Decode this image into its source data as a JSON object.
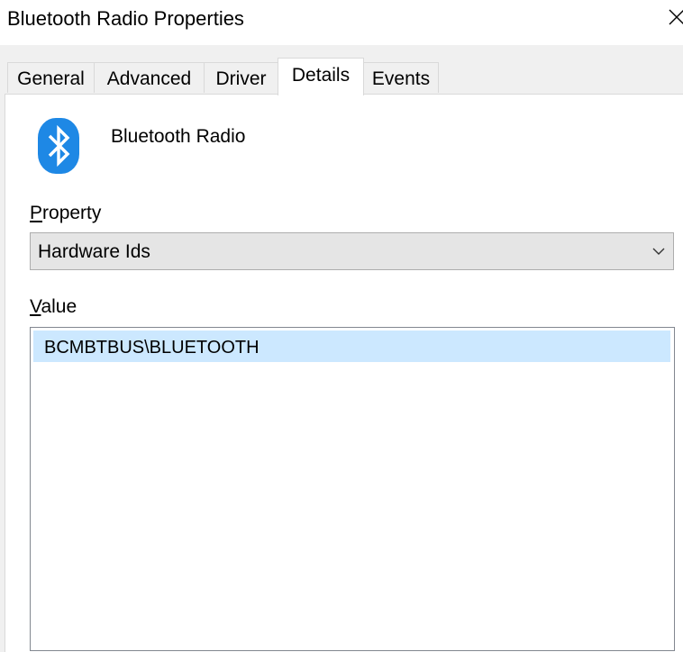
{
  "window": {
    "title": "Bluetooth Radio Properties",
    "close_icon": "close-icon"
  },
  "tabs": [
    {
      "label": "General",
      "active": false
    },
    {
      "label": "Advanced",
      "active": false
    },
    {
      "label": "Driver",
      "active": false
    },
    {
      "label": "Details",
      "active": true
    },
    {
      "label": "Events",
      "active": false
    }
  ],
  "device": {
    "icon": "bluetooth-icon",
    "name": "Bluetooth Radio"
  },
  "property": {
    "label_accel": "P",
    "label_rest": "roperty",
    "selected": "Hardware Ids",
    "chevron_icon": "chevron-down-icon"
  },
  "value": {
    "label_accel": "V",
    "label_rest": "alue",
    "items": [
      "BCMBTBUS\\BLUETOOTH"
    ]
  },
  "colors": {
    "bluetooth_blue": "#1e88e5",
    "selection": "#cce8ff"
  }
}
